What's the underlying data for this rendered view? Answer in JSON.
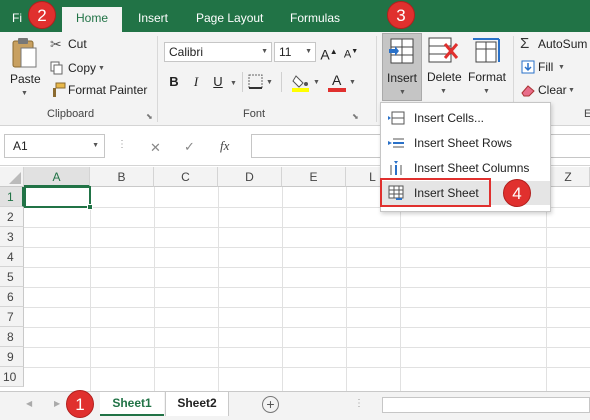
{
  "tabs": {
    "file_partial": "Fi",
    "home": "Home",
    "insert": "Insert",
    "page_layout": "Page Layout",
    "formulas": "Formulas"
  },
  "clipboard": {
    "paste": "Paste",
    "cut": "Cut",
    "copy": "Copy",
    "format_painter": "Format Painter",
    "group_label": "Clipboard"
  },
  "font": {
    "name": "Calibri",
    "size": "11",
    "grow": "A",
    "shrink": "A",
    "bold": "B",
    "italic": "I",
    "underline": "U",
    "font_color_letter": "A",
    "group_label": "Font",
    "fill_color": "#ffff00",
    "font_color": "#e0302e"
  },
  "cells_group": {
    "insert": "Insert",
    "delete": "Delete",
    "format": "Format"
  },
  "editing": {
    "autosum": "AutoSum",
    "fill": "Fill",
    "clear": "Clear"
  },
  "formula_bar": {
    "name_box": "A1",
    "cancel": "✕",
    "enter": "✓",
    "fx": "fx"
  },
  "columns": [
    "A",
    "B",
    "C",
    "D",
    "E",
    "L",
    "Z"
  ],
  "rows": [
    "1",
    "2",
    "3",
    "4",
    "5",
    "6",
    "7",
    "8",
    "9",
    "10"
  ],
  "insert_menu": {
    "items": [
      {
        "label": "Insert Cells..."
      },
      {
        "label": "Insert Sheet Rows"
      },
      {
        "label": "Insert Sheet Columns"
      },
      {
        "label": "Insert Sheet"
      }
    ]
  },
  "sheets": {
    "sheet1": "Sheet1",
    "sheet2": "Sheet2",
    "add": "+"
  },
  "callouts": {
    "one": "1",
    "two": "2",
    "three": "3",
    "four": "4"
  },
  "colors": {
    "accent": "#217346",
    "callout": "#e0302e"
  }
}
